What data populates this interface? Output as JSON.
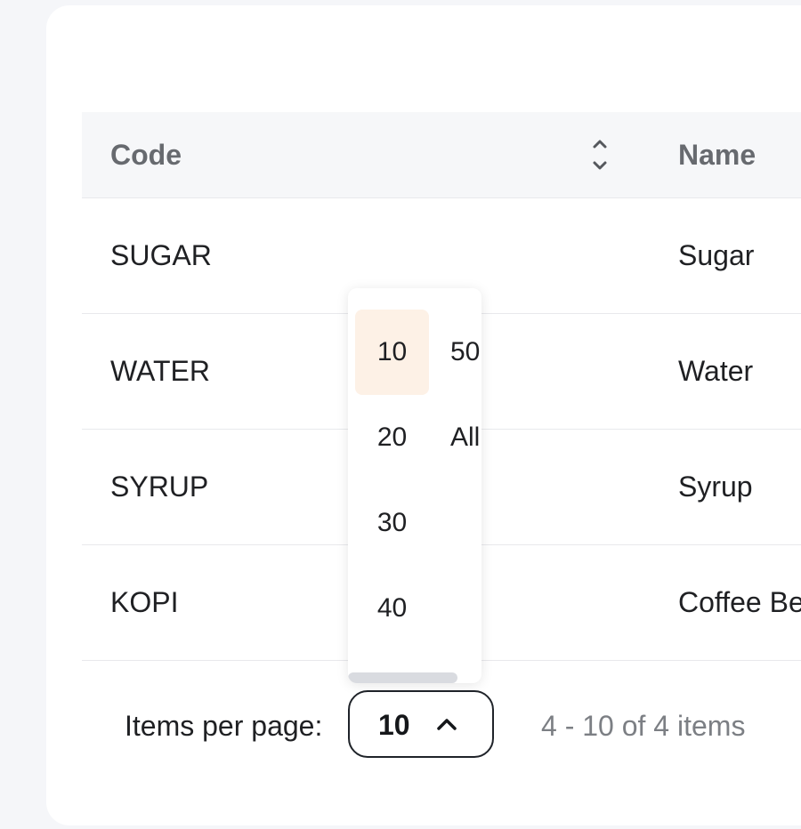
{
  "table": {
    "headers": {
      "code": "Code",
      "name": "Name"
    },
    "sort_icon": "sort-up-down-icon",
    "rows": [
      {
        "code": "SUGAR",
        "name": "Sugar"
      },
      {
        "code": "WATER",
        "name": "Water"
      },
      {
        "code": "SYRUP",
        "name": "Syrup"
      },
      {
        "code": "KOPI",
        "name": "Coffee Be"
      }
    ]
  },
  "pagination": {
    "items_per_page_label": "Items per page:",
    "selected_value": "10",
    "chevron_icon": "chevron-up-icon",
    "range_text": "4 - 10 of 4 items",
    "options": [
      "10",
      "20",
      "30",
      "40",
      "50",
      "All"
    ]
  },
  "colors": {
    "selected_option_bg": "#fdf1e6",
    "header_bg": "#f6f7f9",
    "page_bg": "#f5f6f9"
  }
}
